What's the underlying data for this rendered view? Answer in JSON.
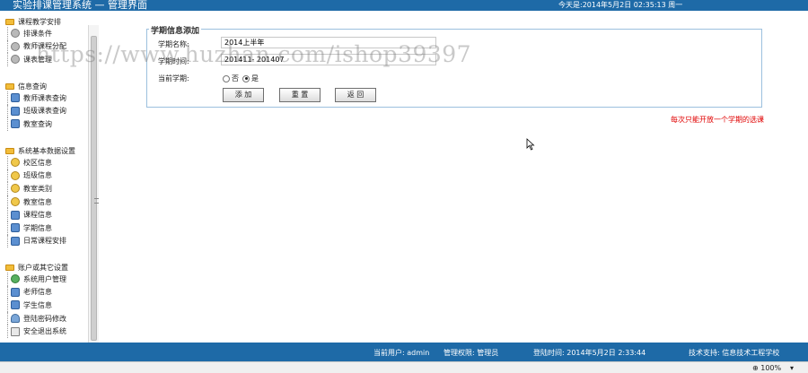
{
  "titlebar": {
    "system_title": "实验排课管理系统 — 管理界面",
    "date_text": "今天是:2014年5月2日  02:35:13   周一"
  },
  "sidebar": {
    "groups": [
      {
        "title": "课程教学安排",
        "items": [
          {
            "label": "排课条件",
            "icon": "gear-icon"
          },
          {
            "label": "教师课程分配",
            "icon": "gear-icon"
          },
          {
            "label": "课表管理",
            "icon": "gear-icon"
          }
        ]
      },
      {
        "title": "信息查询",
        "items": [
          {
            "label": "教师课表查询",
            "icon": "monitor-icon"
          },
          {
            "label": "班级课表查询",
            "icon": "monitor-icon"
          },
          {
            "label": "教室查询",
            "icon": "monitor-icon"
          }
        ]
      },
      {
        "title": "系统基本数据设置",
        "items": [
          {
            "label": "校区信息",
            "icon": "edit-icon"
          },
          {
            "label": "班级信息",
            "icon": "edit-icon"
          },
          {
            "label": "教室类别",
            "icon": "edit-icon"
          },
          {
            "label": "教室信息",
            "icon": "edit-icon"
          },
          {
            "label": "课程信息",
            "icon": "monitor-icon"
          },
          {
            "label": "学期信息",
            "icon": "monitor-icon"
          },
          {
            "label": "日常课程安排",
            "icon": "monitor-icon"
          }
        ]
      },
      {
        "title": "账户或其它设置",
        "items": [
          {
            "label": "系统用户管理",
            "icon": "users-icon"
          },
          {
            "label": "老师信息",
            "icon": "monitor-icon"
          },
          {
            "label": "学生信息",
            "icon": "monitor-icon"
          },
          {
            "label": "登陆密码修改",
            "icon": "key-icon"
          },
          {
            "label": "安全退出系统",
            "icon": "exit-icon"
          }
        ]
      }
    ]
  },
  "form": {
    "legend": "学期信息添加",
    "term_name_label": "学期名称:",
    "term_name_value": "2014上半年",
    "term_time_label": "学期时间:",
    "term_time_value": "201411- 201407",
    "current_term_label": "当前学期:",
    "radio_no": "否",
    "radio_yes": "是",
    "add_button": "添 加",
    "reset_button": "重 置",
    "back_button": "返 回",
    "notice": "每次只能开放一个学期的选课"
  },
  "watermark": "https://www.huzhan.com/ishop39397",
  "footer": {
    "current_user": "当前用户: admin",
    "permission": "管理权限: 管理员",
    "login_time": "登陆时间: 2014年5月2日 2:33:44",
    "support": "技术支持: 信息技术工程学校"
  },
  "statusbar": {
    "zoom": "100%"
  }
}
